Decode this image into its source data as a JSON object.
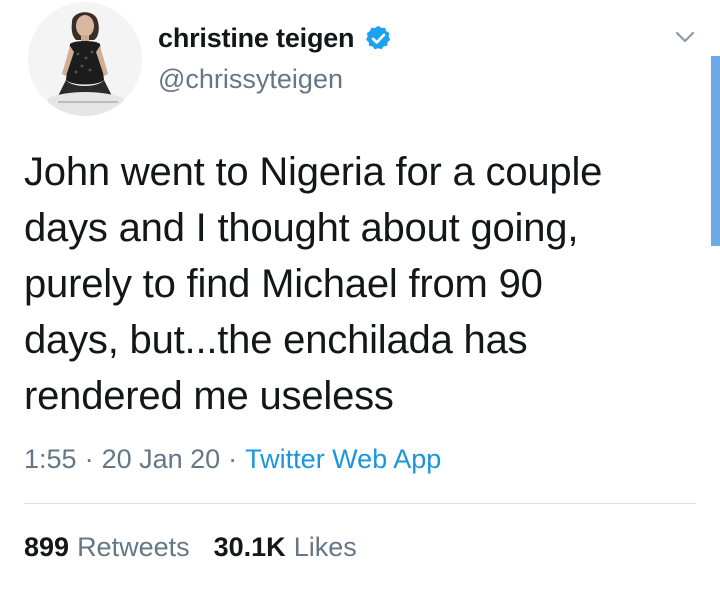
{
  "colors": {
    "text": "#14171a",
    "secondary": "#657786",
    "link": "#1b95e0",
    "verified_badge": "#1da1f2",
    "divider": "#dfe4e8"
  },
  "user": {
    "avatar_icon": "profile-photo",
    "display_name": "christine teigen",
    "verified_icon": "verified-badge-icon",
    "handle": "@chrissyteigen"
  },
  "tweet": {
    "text": "John went to Nigeria for a couple\ndays and I thought about going,\npurely to find Michael from 90\ndays, but...the enchilada has\nrendered me useless",
    "time": "1:55",
    "date": "20 Jan 20",
    "separator": "·",
    "source": "Twitter Web App"
  },
  "stats": {
    "retweets_count": "899",
    "retweets_label": "Retweets",
    "likes_count": "30.1K",
    "likes_label": "Likes"
  },
  "menu_icon": "chevron-down-icon"
}
